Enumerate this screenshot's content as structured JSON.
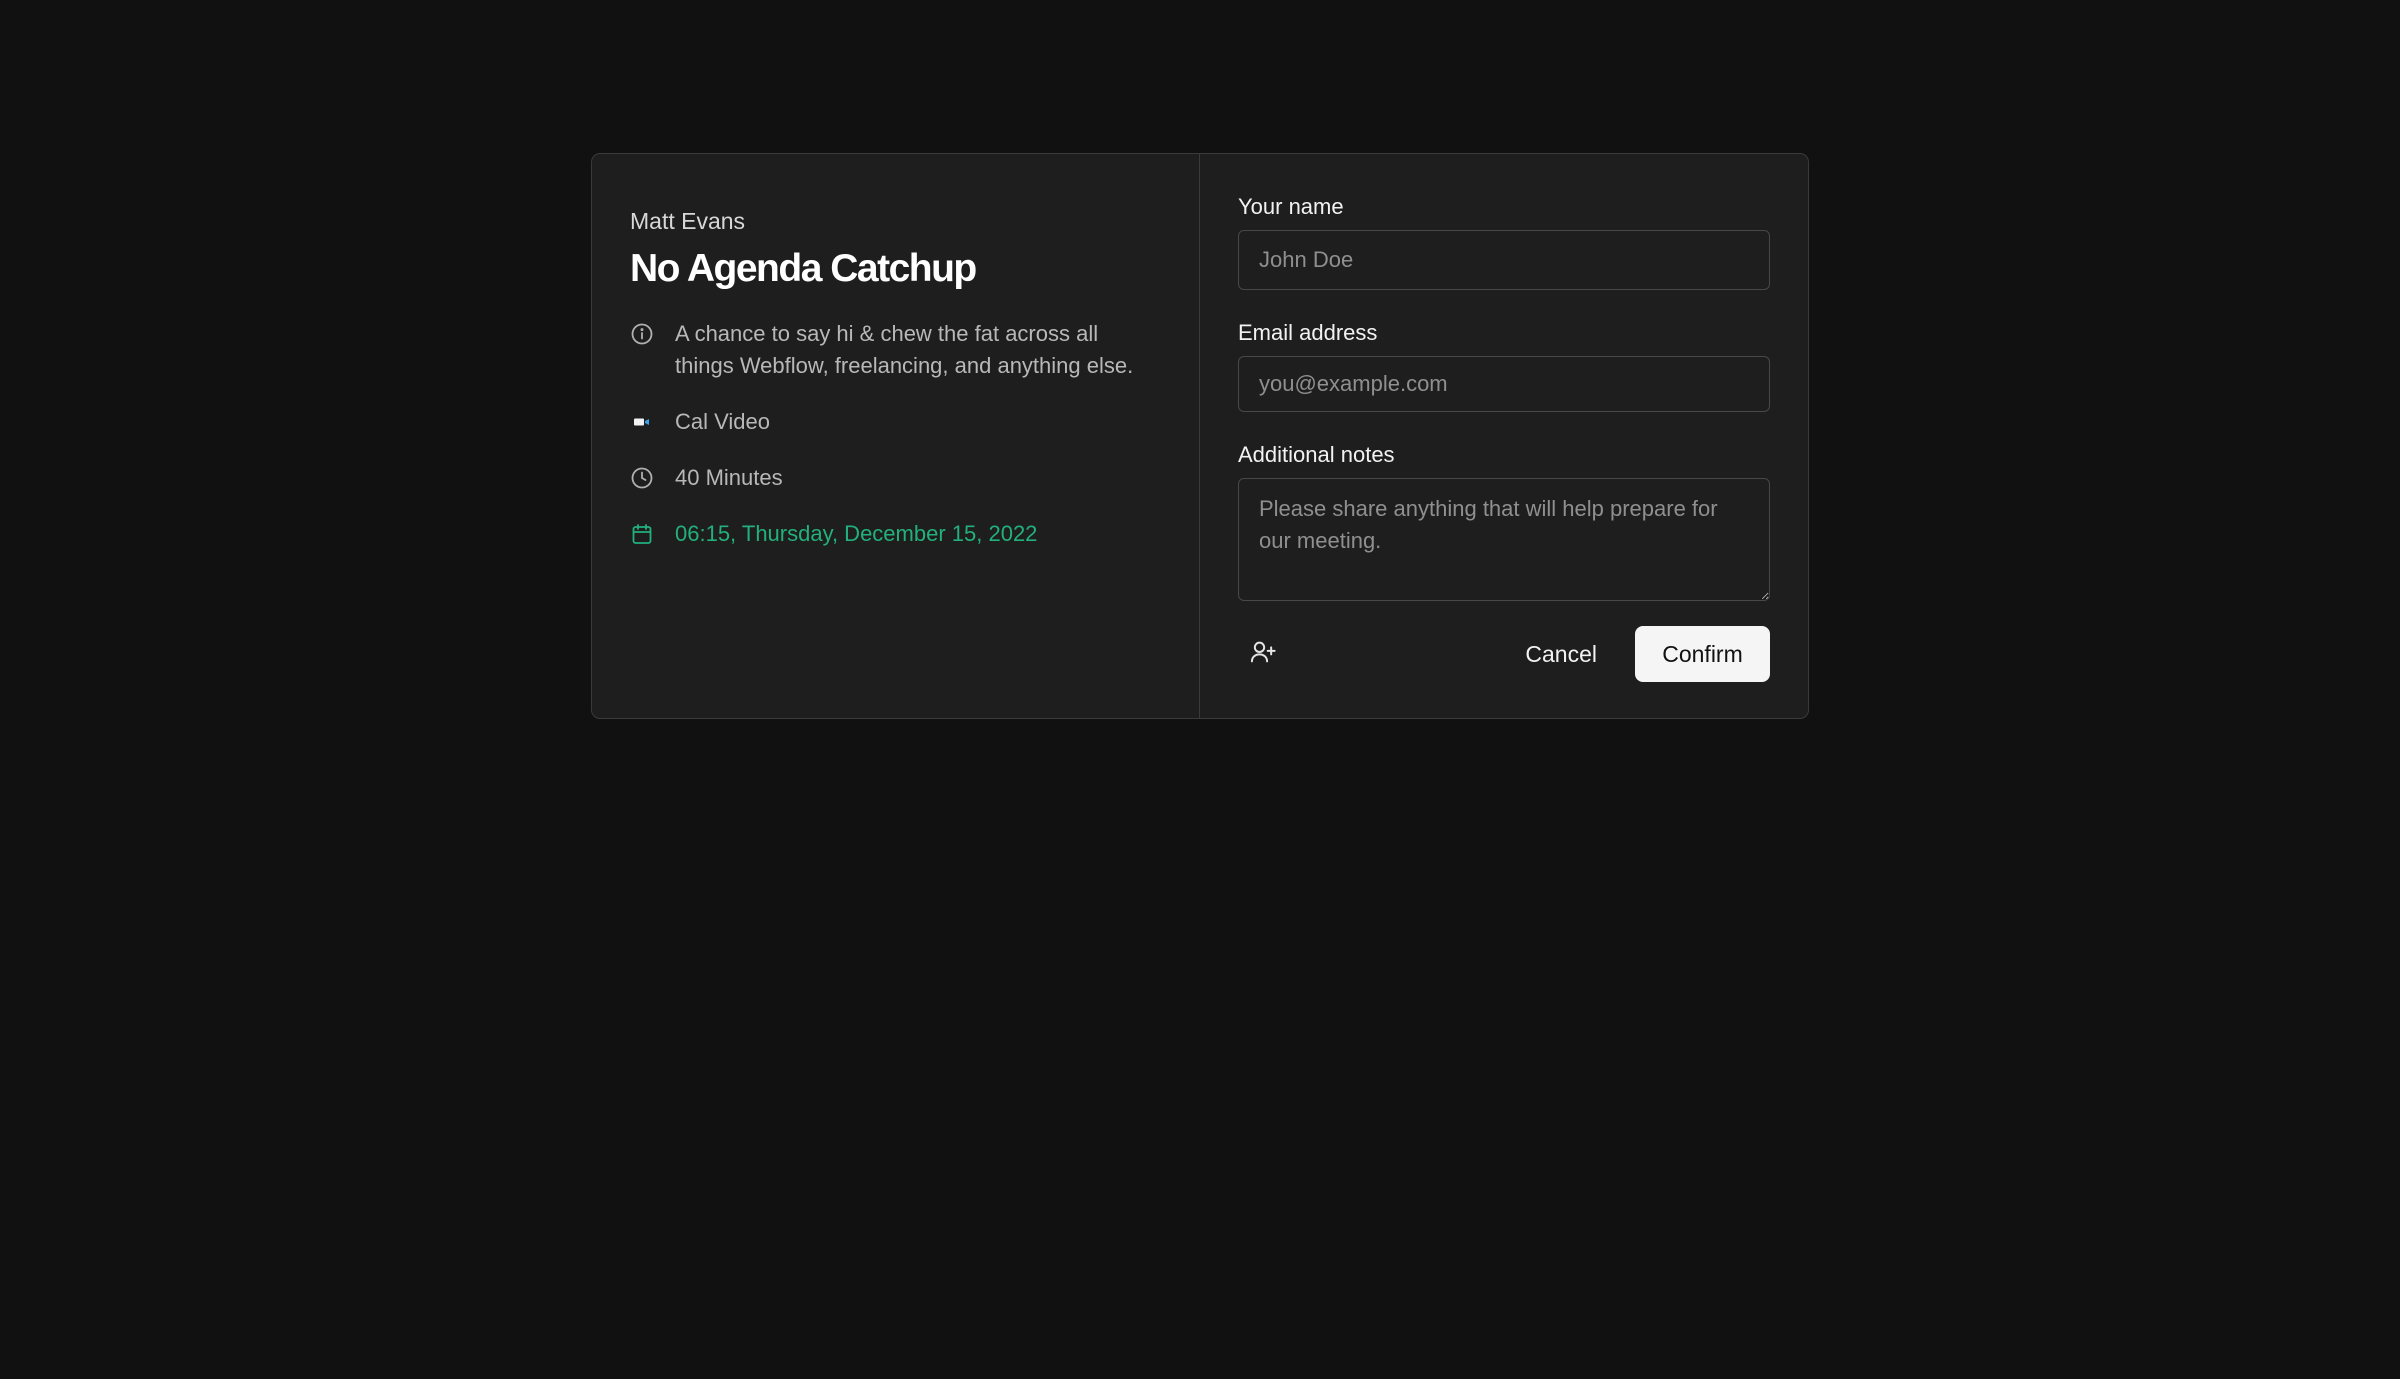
{
  "event": {
    "host": "Matt Evans",
    "title": "No Agenda Catchup",
    "description": "A chance to say hi & chew the fat across all things Webflow, freelancing, and anything else.",
    "location": "Cal Video",
    "duration": "40 Minutes",
    "datetime": "06:15, Thursday, December 15, 2022"
  },
  "form": {
    "name_label": "Your name",
    "name_placeholder": "John Doe",
    "name_value": "",
    "email_label": "Email address",
    "email_placeholder": "you@example.com",
    "email_value": "",
    "notes_label": "Additional notes",
    "notes_placeholder": "Please share anything that will help prepare for our meeting.",
    "notes_value": "",
    "cancel_label": "Cancel",
    "confirm_label": "Confirm"
  },
  "icons": {
    "description": "info-icon",
    "location": "video-icon",
    "duration": "clock-icon",
    "datetime": "calendar-icon",
    "add_guest": "user-plus-icon"
  },
  "colors": {
    "background": "#111111",
    "card": "#1e1e1e",
    "accent_green": "#22b07d",
    "confirm_button": "#f5f5f5"
  }
}
